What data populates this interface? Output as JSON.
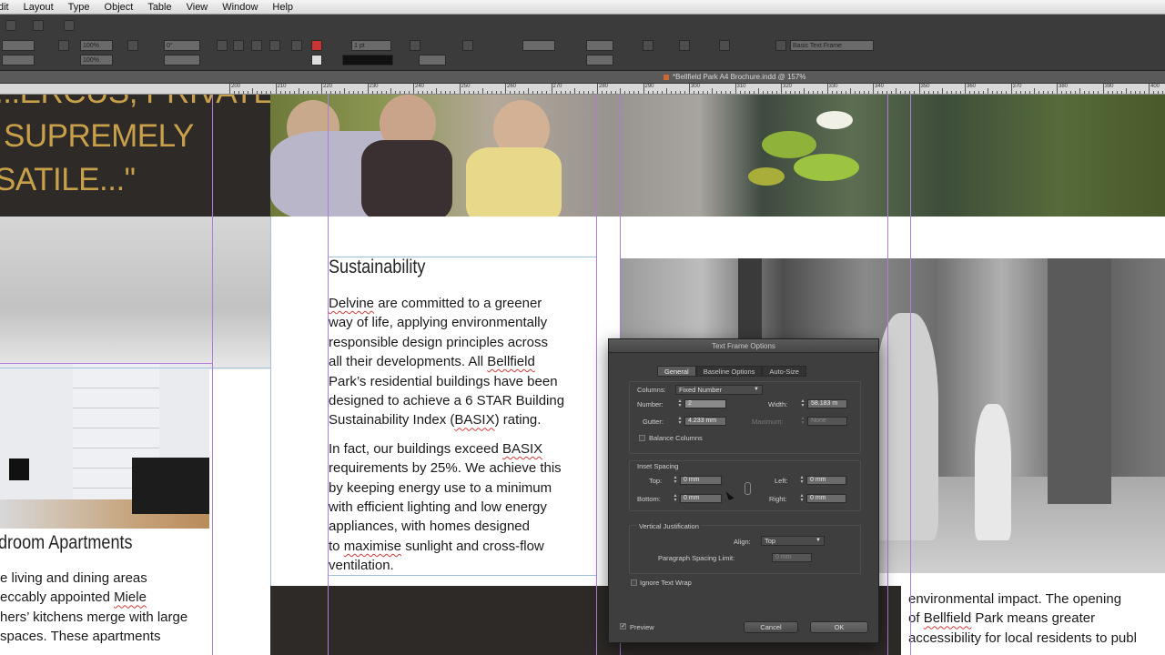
{
  "menu": [
    "dit",
    "Layout",
    "Type",
    "Object",
    "Table",
    "View",
    "Window",
    "Help"
  ],
  "document_tab": "*Bellfield Park A4 Brochure.indd @ 157%",
  "control_panel": {
    "zoom_x": "100%",
    "zoom_y": "100%",
    "angle": "0°",
    "stroke_weight": "1 pt",
    "paragraph_style": "Basic Text Frame"
  },
  "ruler_labels": [
    "200",
    "210",
    "220",
    "230",
    "240",
    "250",
    "260",
    "270",
    "280",
    "290",
    "300",
    "310",
    "320",
    "330",
    "340",
    "350",
    "360",
    "370",
    "380",
    "390",
    "400"
  ],
  "quote": [
    "...ERCUS, PRIVATE",
    "SUPREMELY",
    "SATILE...\""
  ],
  "sustainability": {
    "heading": "Sustainability",
    "p1_lines": [
      [
        "Delvine",
        " are committed to a greener"
      ],
      [
        "way of life, applying environmentally"
      ],
      [
        "responsible design principles across"
      ],
      [
        "all their developments. All ",
        "Bellfield"
      ],
      [
        "Park’s residential buildings have been"
      ],
      [
        "designed to achieve a 6 STAR Building"
      ],
      [
        "Sustainability Index (",
        "BASIX",
        ") rating."
      ]
    ],
    "p2_lines": [
      [
        "In fact, our buildings exceed ",
        "BASIX"
      ],
      [
        "requirements by 25%. We achieve this"
      ],
      [
        "by keeping energy use to a minimum"
      ],
      [
        "with efficient lighting and low energy"
      ],
      [
        "appliances, with homes designed"
      ],
      [
        "to ",
        "maximise",
        " sunlight and cross-flow"
      ],
      [
        "ventilation."
      ]
    ]
  },
  "apartments": {
    "heading": "droom Apartments",
    "lines": [
      [
        "e living and dining areas"
      ],
      [
        "eccably appointed ",
        "Miele"
      ],
      [
        "hers’ kitchens merge with large"
      ],
      [
        "spaces. These apartments"
      ]
    ]
  },
  "right_text": {
    "lines": [
      [
        "environmental impact. The opening"
      ],
      [
        "of ",
        "Bellfield",
        " Park means greater"
      ],
      [
        "accessibility for local residents to publ"
      ]
    ]
  },
  "dialog": {
    "title": "Text Frame Options",
    "tabs": [
      "General",
      "Baseline Options",
      "Auto-Size"
    ],
    "columns_label": "Columns:",
    "columns_value": "Fixed Number",
    "number_label": "Number:",
    "number_value": "2",
    "width_label": "Width:",
    "width_value": "58.183 m",
    "gutter_label": "Gutter:",
    "gutter_value": "4.233 mm",
    "maximum_label": "Maximum:",
    "maximum_value": "None",
    "balance_columns_label": "Balance Columns",
    "inset_spacing_label": "Inset Spacing",
    "top_label": "Top:",
    "top_value": "0 mm",
    "bottom_label": "Bottom:",
    "bottom_value": "0 mm",
    "left_label": "Left:",
    "left_value": "0 mm",
    "right_label": "Right:",
    "right_value": "0 mm",
    "vertical_justification_label": "Vertical Justification",
    "align_label": "Align:",
    "align_value": "Top",
    "para_spacing_label": "Paragraph Spacing Limit:",
    "para_spacing_value": "0 mm",
    "ignore_text_wrap_label": "Ignore Text Wrap",
    "preview_label": "Preview",
    "preview_checked": true,
    "cancel_label": "Cancel",
    "ok_label": "OK"
  },
  "colors": {
    "quote_gold": "#c9a04a",
    "dark_panel": "#2d2a28",
    "guide_purple": "#b07bd9",
    "spell_red": "#d13b3b"
  }
}
